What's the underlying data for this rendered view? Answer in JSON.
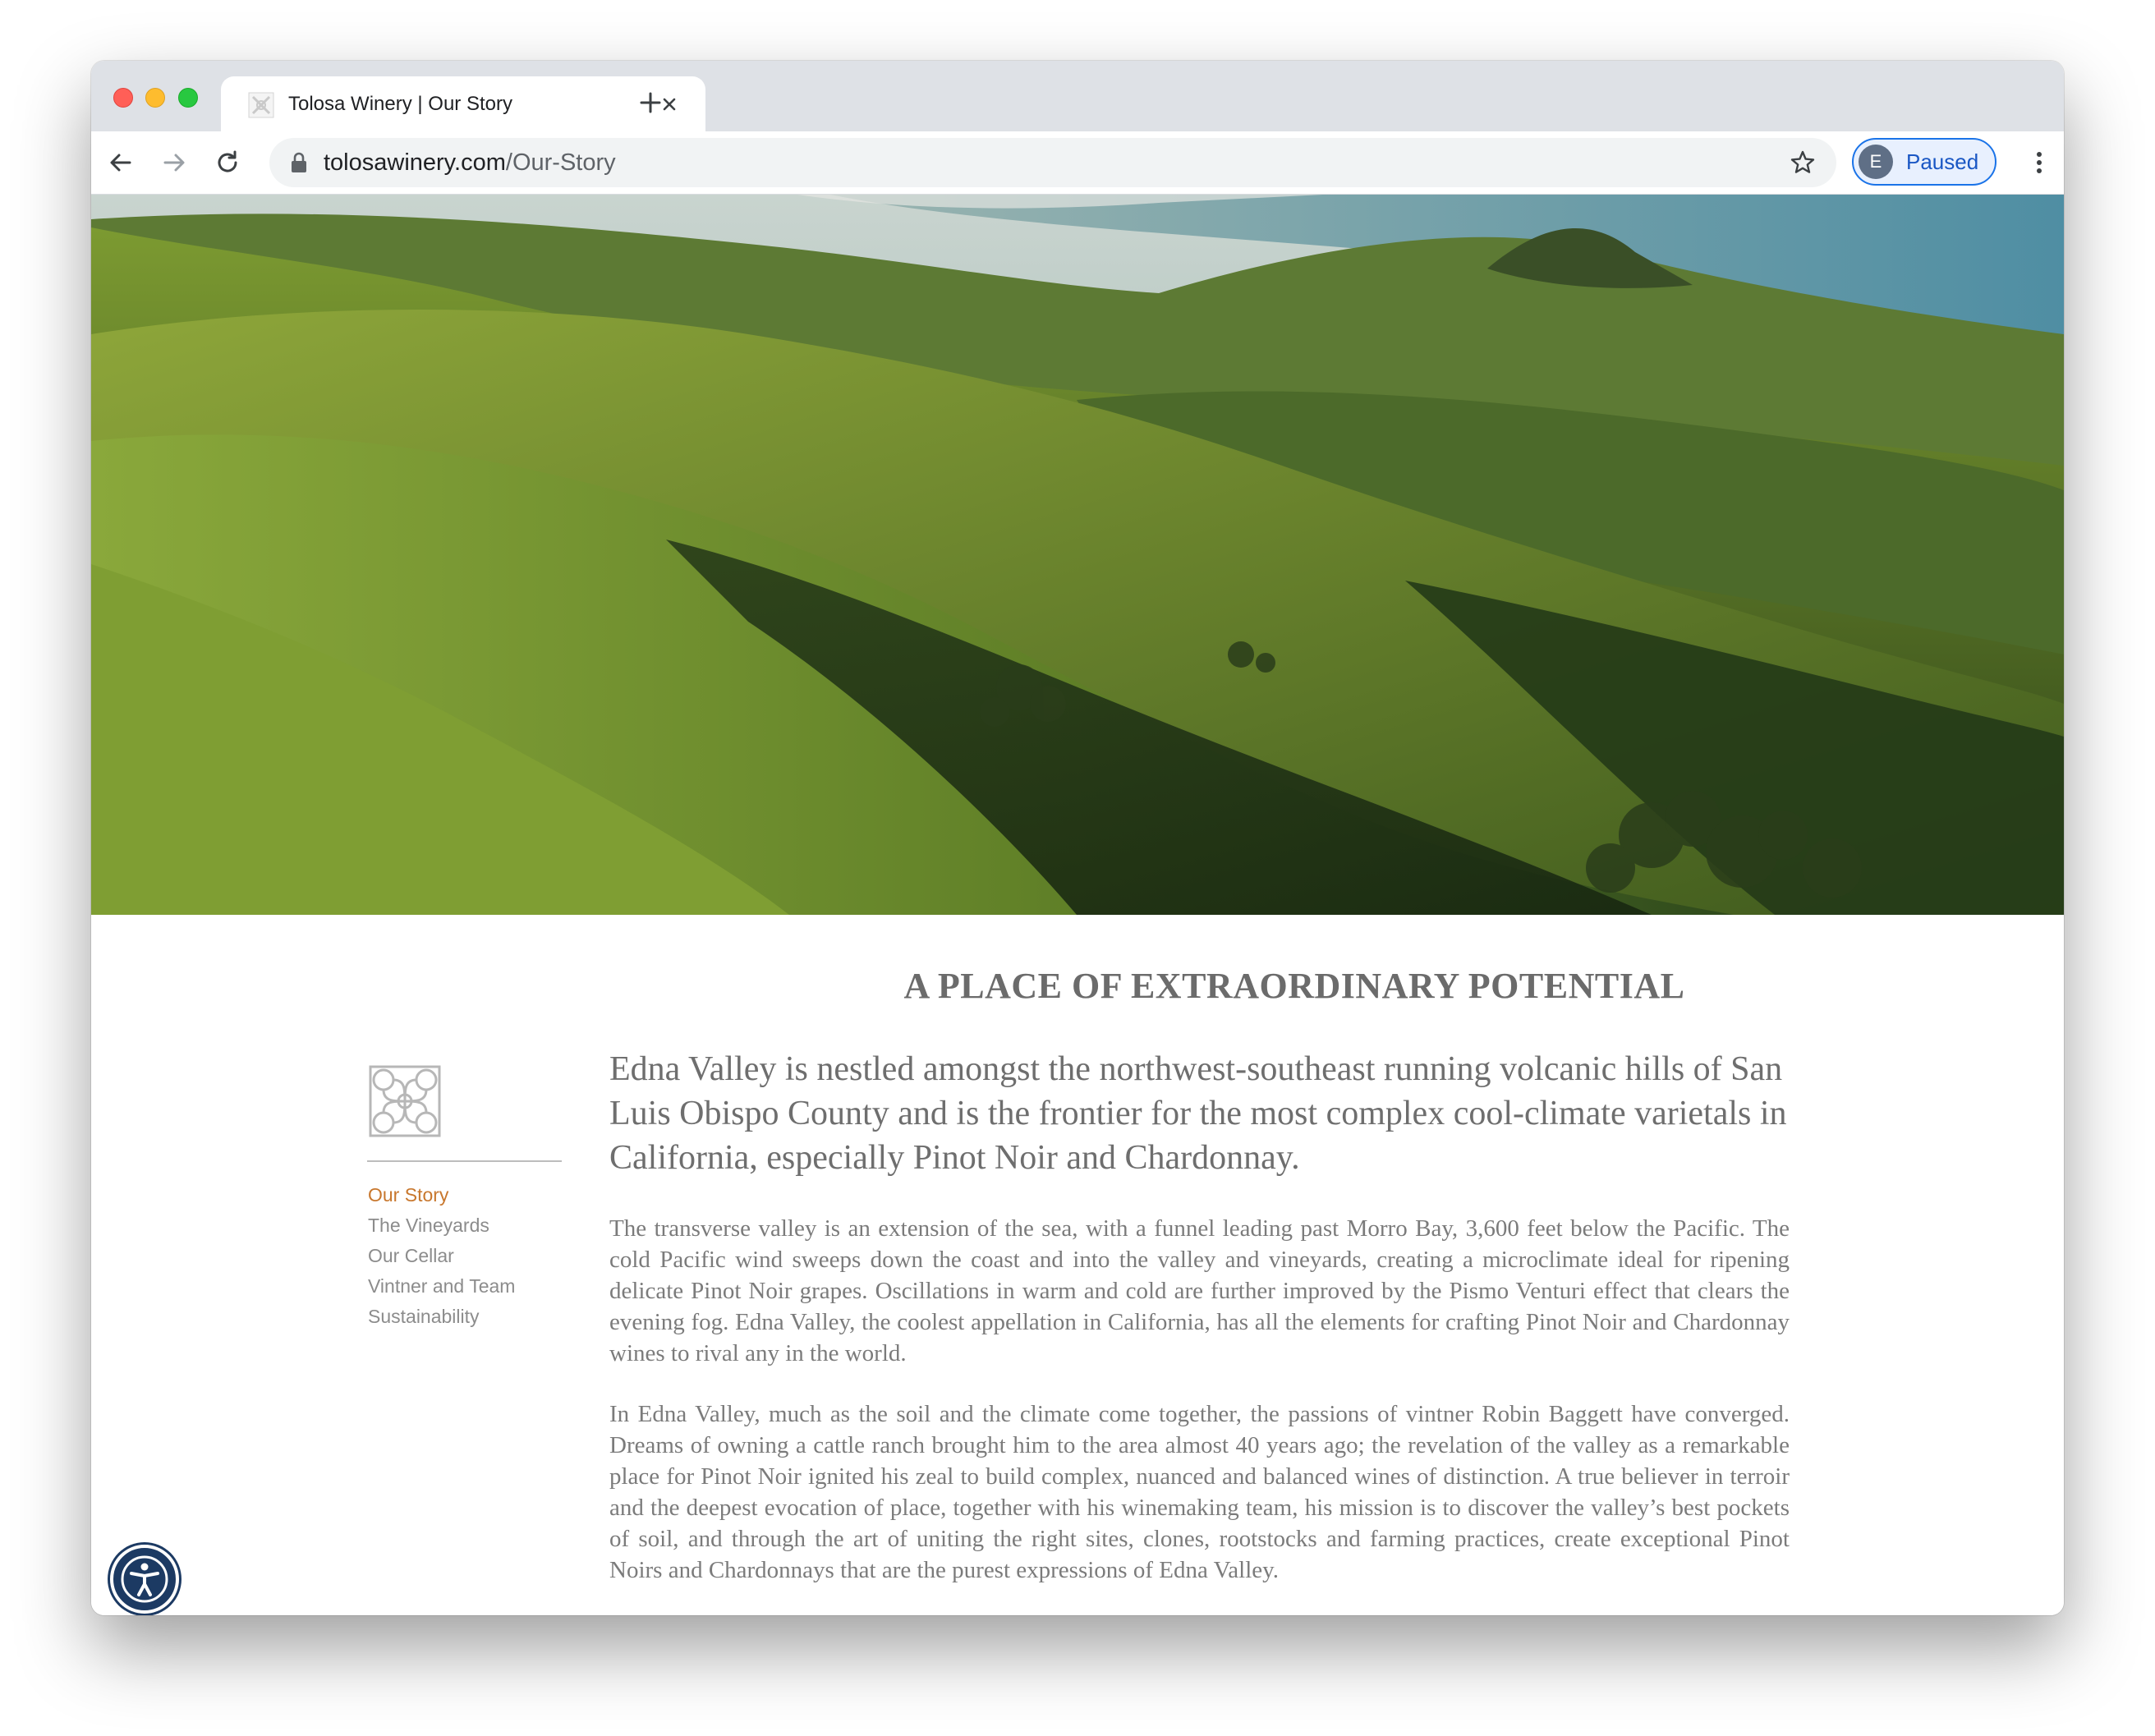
{
  "browser": {
    "tab": {
      "title": "Tolosa Winery | Our Story"
    },
    "address": {
      "host": "tolosawinery.com",
      "path": "/Our-Story"
    },
    "profile": {
      "initial": "E",
      "status": "Paused"
    }
  },
  "page": {
    "headline": "A PLACE OF EXTRAORDINARY POTENTIAL",
    "lead": "Edna Valley is nestled amongst the northwest-southeast running volcanic hills of San Luis Obispo County and is the frontier for the most complex cool-climate varietals in California, especially Pinot Noir and Chardonnay.",
    "paragraphs": [
      "The transverse valley is an extension of the sea, with a funnel leading past Morro Bay, 3,600 feet below the Pacific. The cold Pacific wind sweeps down the coast and into the valley and vineyards, creating a microclimate ideal for ripening delicate Pinot Noir grapes. Oscillations in warm and cold are further improved by the Pismo Venturi effect that clears the evening fog. Edna Valley, the coolest appellation in California, has all the elements for crafting Pinot Noir and Chardonnay wines to rival any in the world.",
      "In Edna Valley, much as the soil and the climate come together, the passions of vintner Robin Baggett have converged. Dreams of owning a cattle ranch brought him to the area almost 40 years ago; the revelation of the valley as a remarkable place for Pinot Noir ignited his zeal to build complex, nuanced and balanced wines of distinction.  A true believer in terroir and the deepest evocation of place, together with his winemaking team, his mission is to discover the valley’s best pockets of soil, and through the art of uniting the right sites, clones, rootstocks and farming practices, create exceptional Pinot Noirs and Chardonnays that are the purest expressions of Edna Valley."
    ]
  },
  "sidebar": {
    "items": [
      {
        "label": "Our Story",
        "active": true
      },
      {
        "label": "The Vineyards"
      },
      {
        "label": "Our Cellar"
      },
      {
        "label": "Vintner and Team"
      },
      {
        "label": "Sustainability"
      }
    ]
  },
  "icons": {
    "back": "arrow-left-icon",
    "forward": "arrow-right-icon",
    "reload": "reload-icon",
    "lock": "lock-icon",
    "bookmark": "star-icon",
    "menu": "more-vert-icon",
    "accessibility": "accessibility-icon",
    "logo": "tolosa-knot-logo"
  },
  "colors": {
    "tabstrip": "#dee1e6",
    "nav_active": "#c8772d",
    "nav_default": "#8c8c8c",
    "headline": "#6b6b6b",
    "accessibility_button": "#1c3a63",
    "profile_accent": "#1a73e8"
  }
}
